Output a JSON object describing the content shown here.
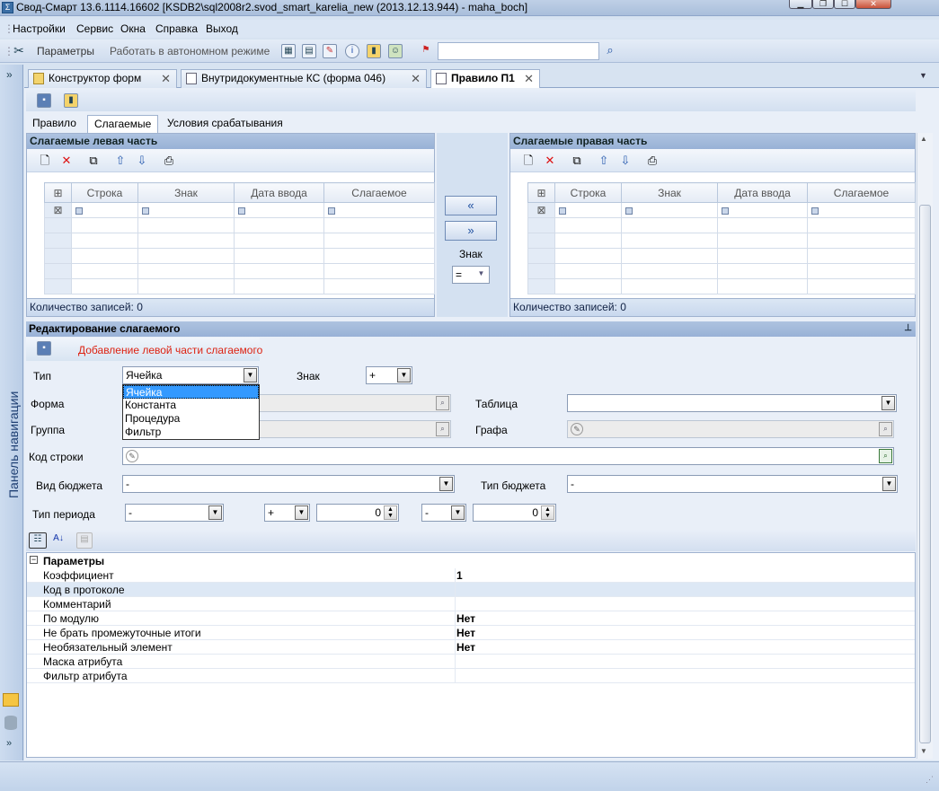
{
  "window": {
    "title": "Свод-Смарт 13.6.1114.16602 [KSDB2\\sql2008r2.svod_smart_karelia_new (2013.12.13.944) - maha_boch]"
  },
  "menu": [
    "Настройки",
    "Сервис",
    "Окна",
    "Справка",
    "Выход"
  ],
  "toolbar": {
    "params_label": "Параметры",
    "offline_label": "Работать в автономном режиме",
    "search_value": ""
  },
  "nav_panel": {
    "label": "Панель навигации"
  },
  "doc_tabs": [
    {
      "label": "Конструктор форм"
    },
    {
      "label": "Внутридокументные КС (форма 046)"
    },
    {
      "label": "Правило П1"
    }
  ],
  "page_tabs": [
    "Правило",
    "Слагаемые",
    "Условия срабатывания"
  ],
  "left_grid": {
    "title": "Слагаемые левая часть",
    "columns": [
      "Строка",
      "Знак",
      "Дата ввода",
      "Слагаемое"
    ],
    "footer": "Количество записей: 0"
  },
  "right_grid": {
    "title": "Слагаемые правая часть",
    "columns": [
      "Строка",
      "Знак",
      "Дата ввода",
      "Слагаемое"
    ],
    "footer": "Количество записей: 0"
  },
  "middle": {
    "move_left": "«",
    "move_right": "»",
    "sign_label": "Знак",
    "sign_value": "="
  },
  "editor": {
    "header": "Редактирование слагаемого",
    "add_label": "Добавление левой части слагаемого",
    "type_label": "Тип",
    "type_value": "Ячейка",
    "type_options": [
      "Ячейка",
      "Константа",
      "Процедура",
      "Фильтр"
    ],
    "sign_label": "Знак",
    "sign_value": "+",
    "form_label": "Форма",
    "table_label": "Таблица",
    "group_label": "Группа",
    "column_label": "Графа",
    "row_code_label": "Код строки",
    "budget_view_label": "Вид бюджета",
    "budget_view_value": "-",
    "budget_type_label": "Тип бюджета",
    "budget_type_value": "-",
    "period_type_label": "Тип периода",
    "period_type_value": "-",
    "period_sign1": "+",
    "period_num1": "0",
    "period_sign2": "-",
    "period_num2": "0"
  },
  "properties": {
    "group": "Параметры",
    "rows": [
      {
        "key": "Коэффициент",
        "value": "1"
      },
      {
        "key": "Код в протоколе",
        "value": ""
      },
      {
        "key": "Комментарий",
        "value": ""
      },
      {
        "key": "По модулю",
        "value": "Нет"
      },
      {
        "key": "Не брать промежуточные итоги",
        "value": "Нет"
      },
      {
        "key": "Необязательный элемент",
        "value": "Нет"
      },
      {
        "key": "Маска атрибута",
        "value": ""
      },
      {
        "key": "Фильтр атрибута",
        "value": ""
      }
    ]
  }
}
